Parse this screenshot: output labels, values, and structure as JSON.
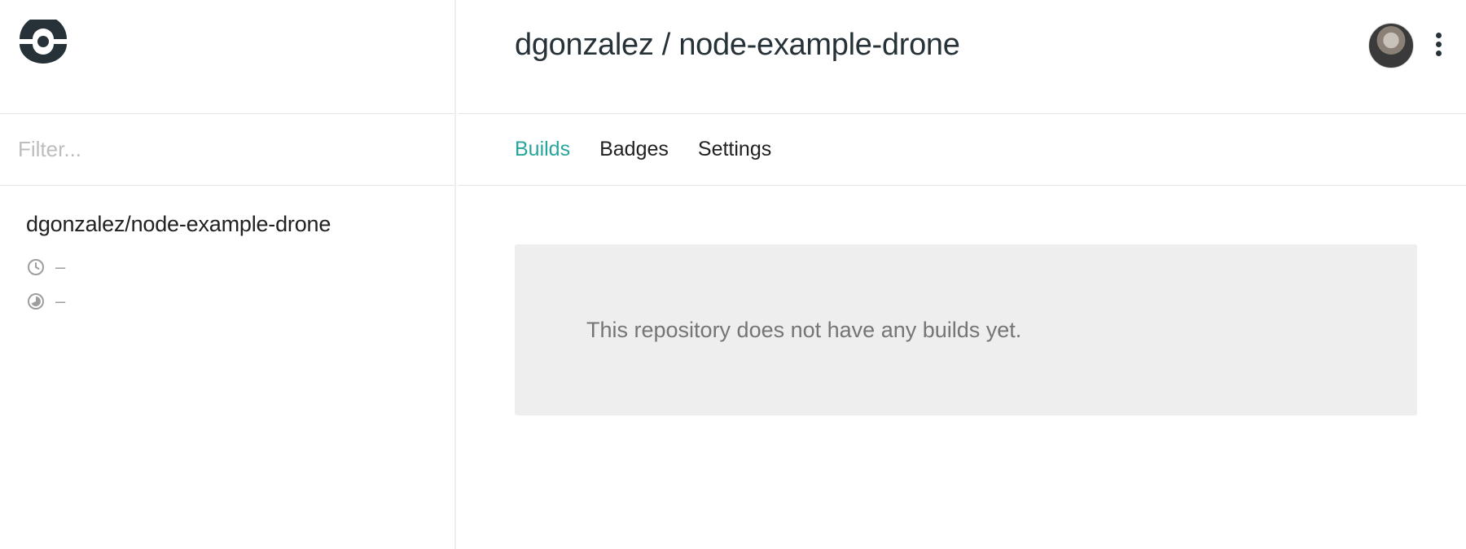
{
  "sidebar": {
    "logo_icon": "drone-logo-icon",
    "filter": {
      "placeholder": "Filter...",
      "value": ""
    },
    "repos": [
      {
        "name": "dgonzalez/node-example-drone",
        "elapsed": "–",
        "duration": "–"
      }
    ]
  },
  "header": {
    "title": "dgonzalez / node-example-drone",
    "avatar": "user-avatar",
    "menu_icon": "more-vert-icon"
  },
  "tabs": [
    {
      "label": "Builds",
      "active": true
    },
    {
      "label": "Badges",
      "active": false
    },
    {
      "label": "Settings",
      "active": false
    }
  ],
  "main": {
    "empty_message": "This repository does not have any builds yet."
  },
  "colors": {
    "accent": "#26a69a",
    "text": "#212121",
    "muted": "#9e9e9e",
    "empty_bg": "#eeeeee"
  }
}
